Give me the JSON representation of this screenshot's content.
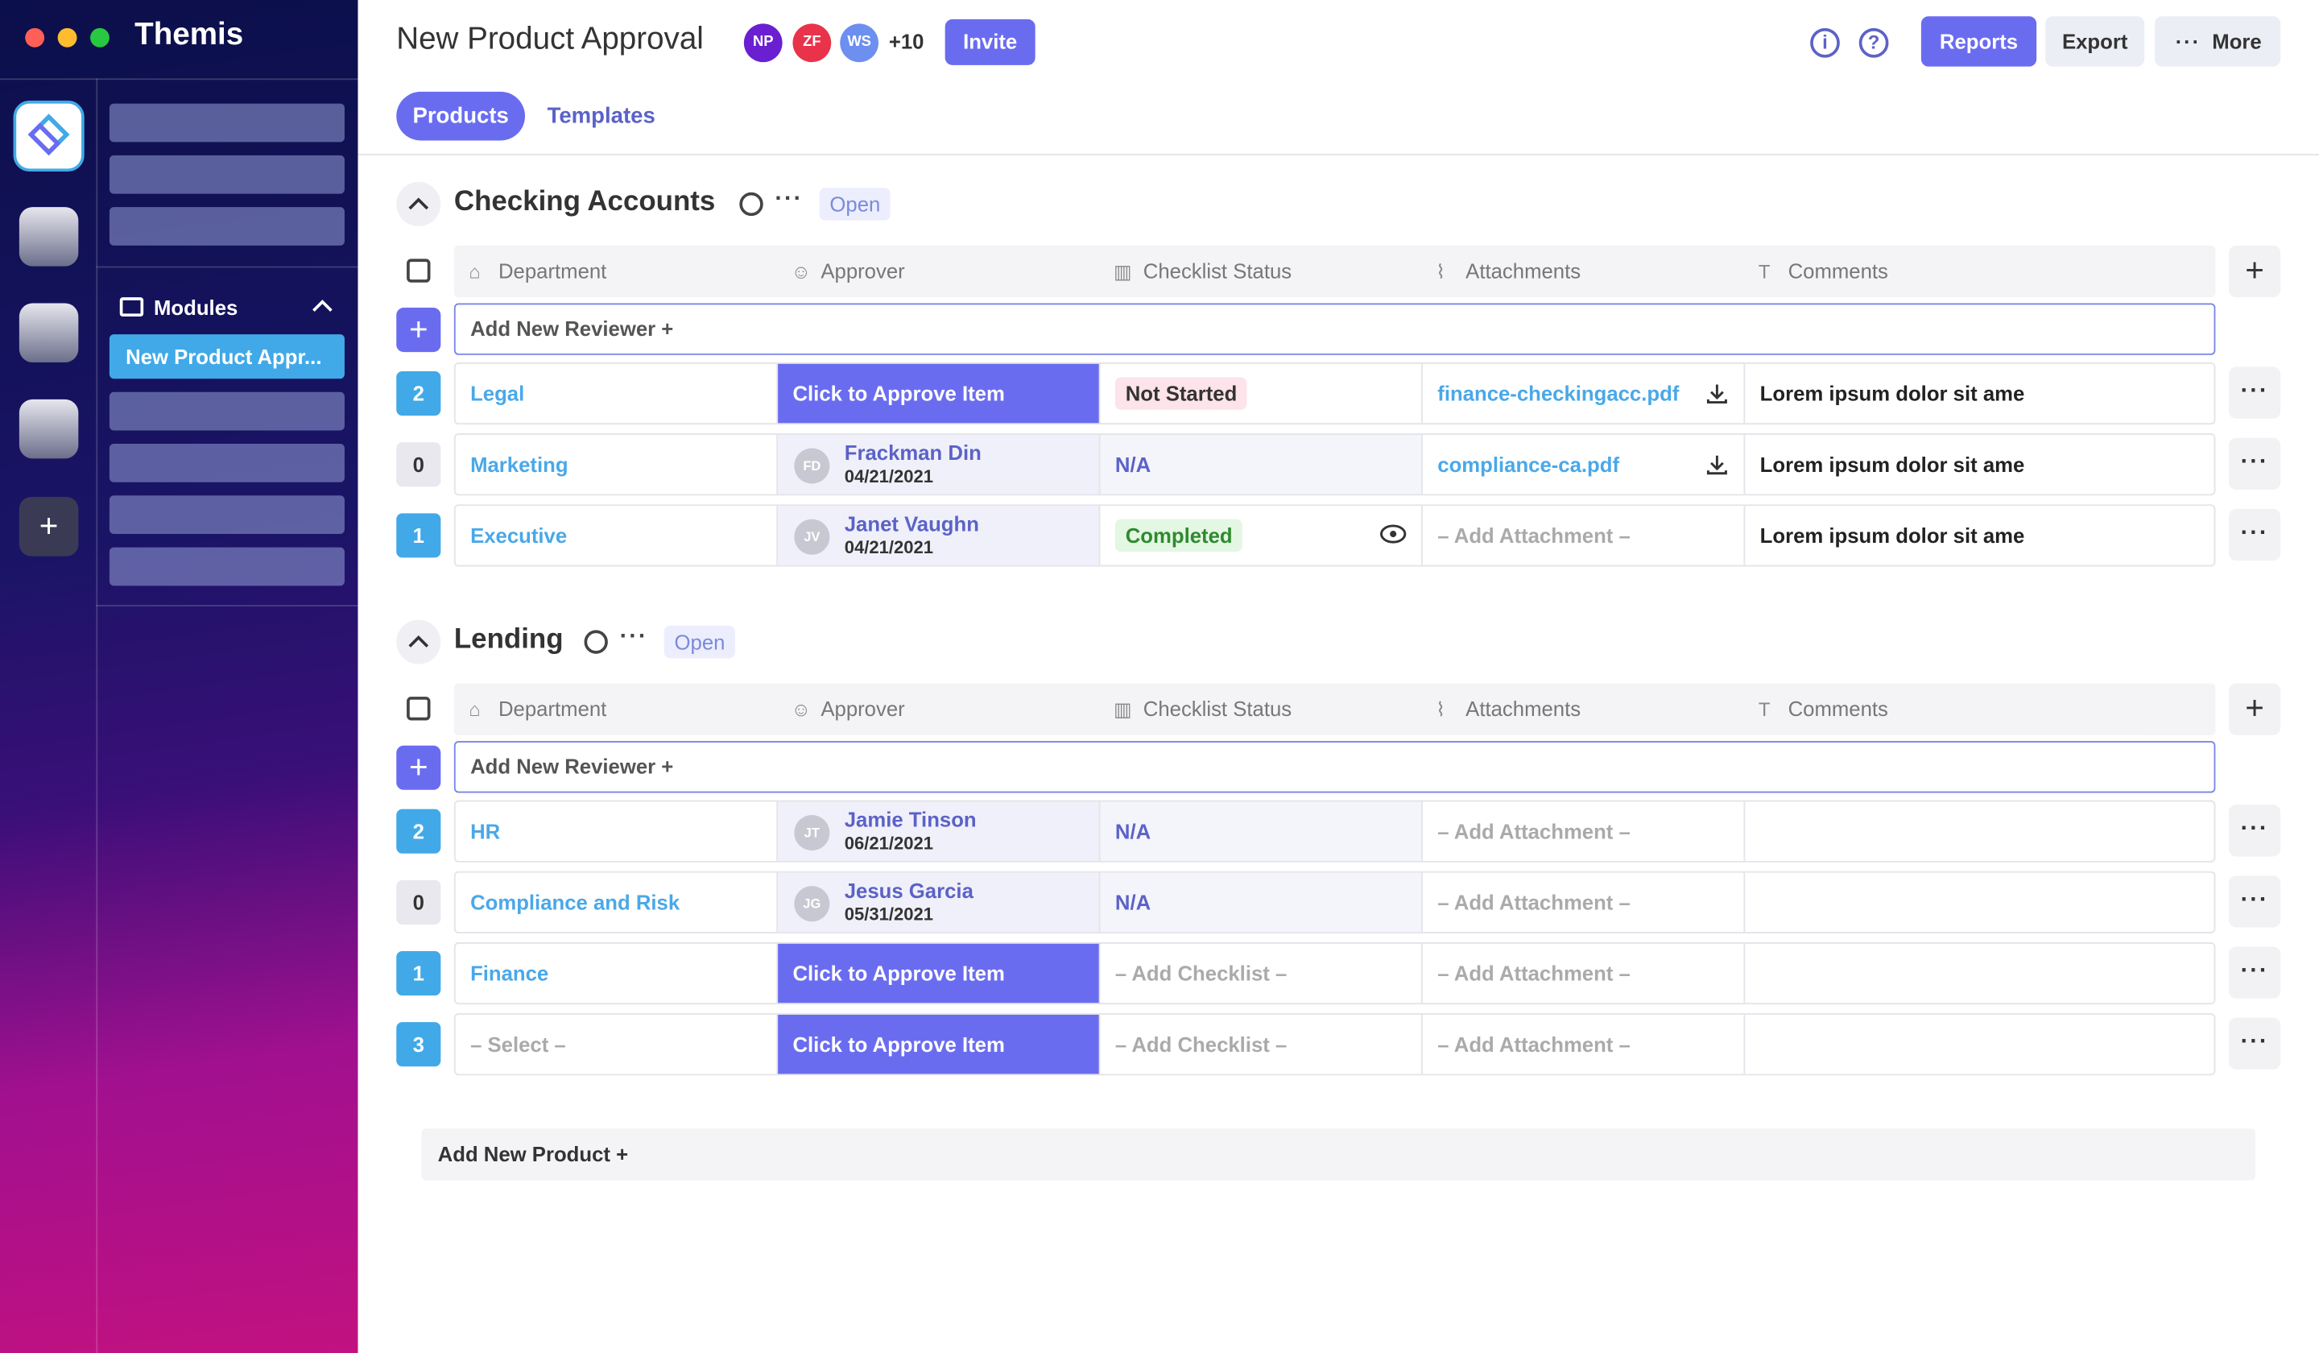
{
  "app": {
    "name": "Themis"
  },
  "colors": {
    "accent": "#6a6cf0",
    "link": "#4aa8e8",
    "not_started_bg": "#fde3ea",
    "completed_bg": "#e3f7e3"
  },
  "sidebar": {
    "modules_label": "Modules",
    "active_module": "New Product Appr..."
  },
  "header": {
    "title": "New Product Approval",
    "avatars": [
      "NP",
      "ZF",
      "WS"
    ],
    "extra_count": "+10",
    "invite_label": "Invite",
    "info_icon": "i",
    "help_icon": "?",
    "reports_label": "Reports",
    "export_label": "Export",
    "more_label": "More"
  },
  "tabs": [
    {
      "label": "Products",
      "active": true
    },
    {
      "label": "Templates",
      "active": false
    }
  ],
  "columns": [
    "Department",
    "Approver",
    "Checklist Status",
    "Attachments",
    "Comments"
  ],
  "add_reviewer_label": "Add New Reviewer +",
  "add_product_label": "Add New Product +",
  "sections": [
    {
      "name": "Checking Accounts",
      "status": "Open",
      "rows": [
        {
          "count": "2",
          "department": "Legal",
          "approver_action": "Click to Approve Item",
          "status": "Not Started",
          "attachment": "finance-checkingacc.pdf",
          "comment": "Lorem ipsum dolor sit ame"
        },
        {
          "count": "0",
          "department": "Marketing",
          "approver_initials": "FD",
          "approver_name": "Frackman Din",
          "approver_date": "04/21/2021",
          "status": "N/A",
          "attachment": "compliance-ca.pdf",
          "comment": "Lorem ipsum dolor sit ame"
        },
        {
          "count": "1",
          "department": "Executive",
          "approver_initials": "JV",
          "approver_name": "Janet Vaughn",
          "approver_date": "04/21/2021",
          "status": "Completed",
          "attachment": "– Add Attachment –",
          "comment": "Lorem ipsum dolor sit ame"
        }
      ]
    },
    {
      "name": "Lending",
      "status": "Open",
      "rows": [
        {
          "count": "2",
          "department": "HR",
          "approver_initials": "JT",
          "approver_name": "Jamie Tinson",
          "approver_date": "06/21/2021",
          "status": "N/A",
          "attachment": "– Add Attachment –",
          "comment": ""
        },
        {
          "count": "0",
          "department": "Compliance and Risk",
          "approver_initials": "JG",
          "approver_name": "Jesus Garcia",
          "approver_date": "05/31/2021",
          "status": "N/A",
          "attachment": "– Add Attachment –",
          "comment": ""
        },
        {
          "count": "1",
          "department": "Finance",
          "approver_action": "Click to Approve Item",
          "status": "– Add Checklist –",
          "attachment": "– Add Attachment –",
          "comment": ""
        },
        {
          "count": "3",
          "department": "– Select –",
          "approver_action": "Click to Approve Item",
          "status": "– Add Checklist –",
          "attachment": "– Add Attachment –",
          "comment": ""
        }
      ]
    }
  ]
}
